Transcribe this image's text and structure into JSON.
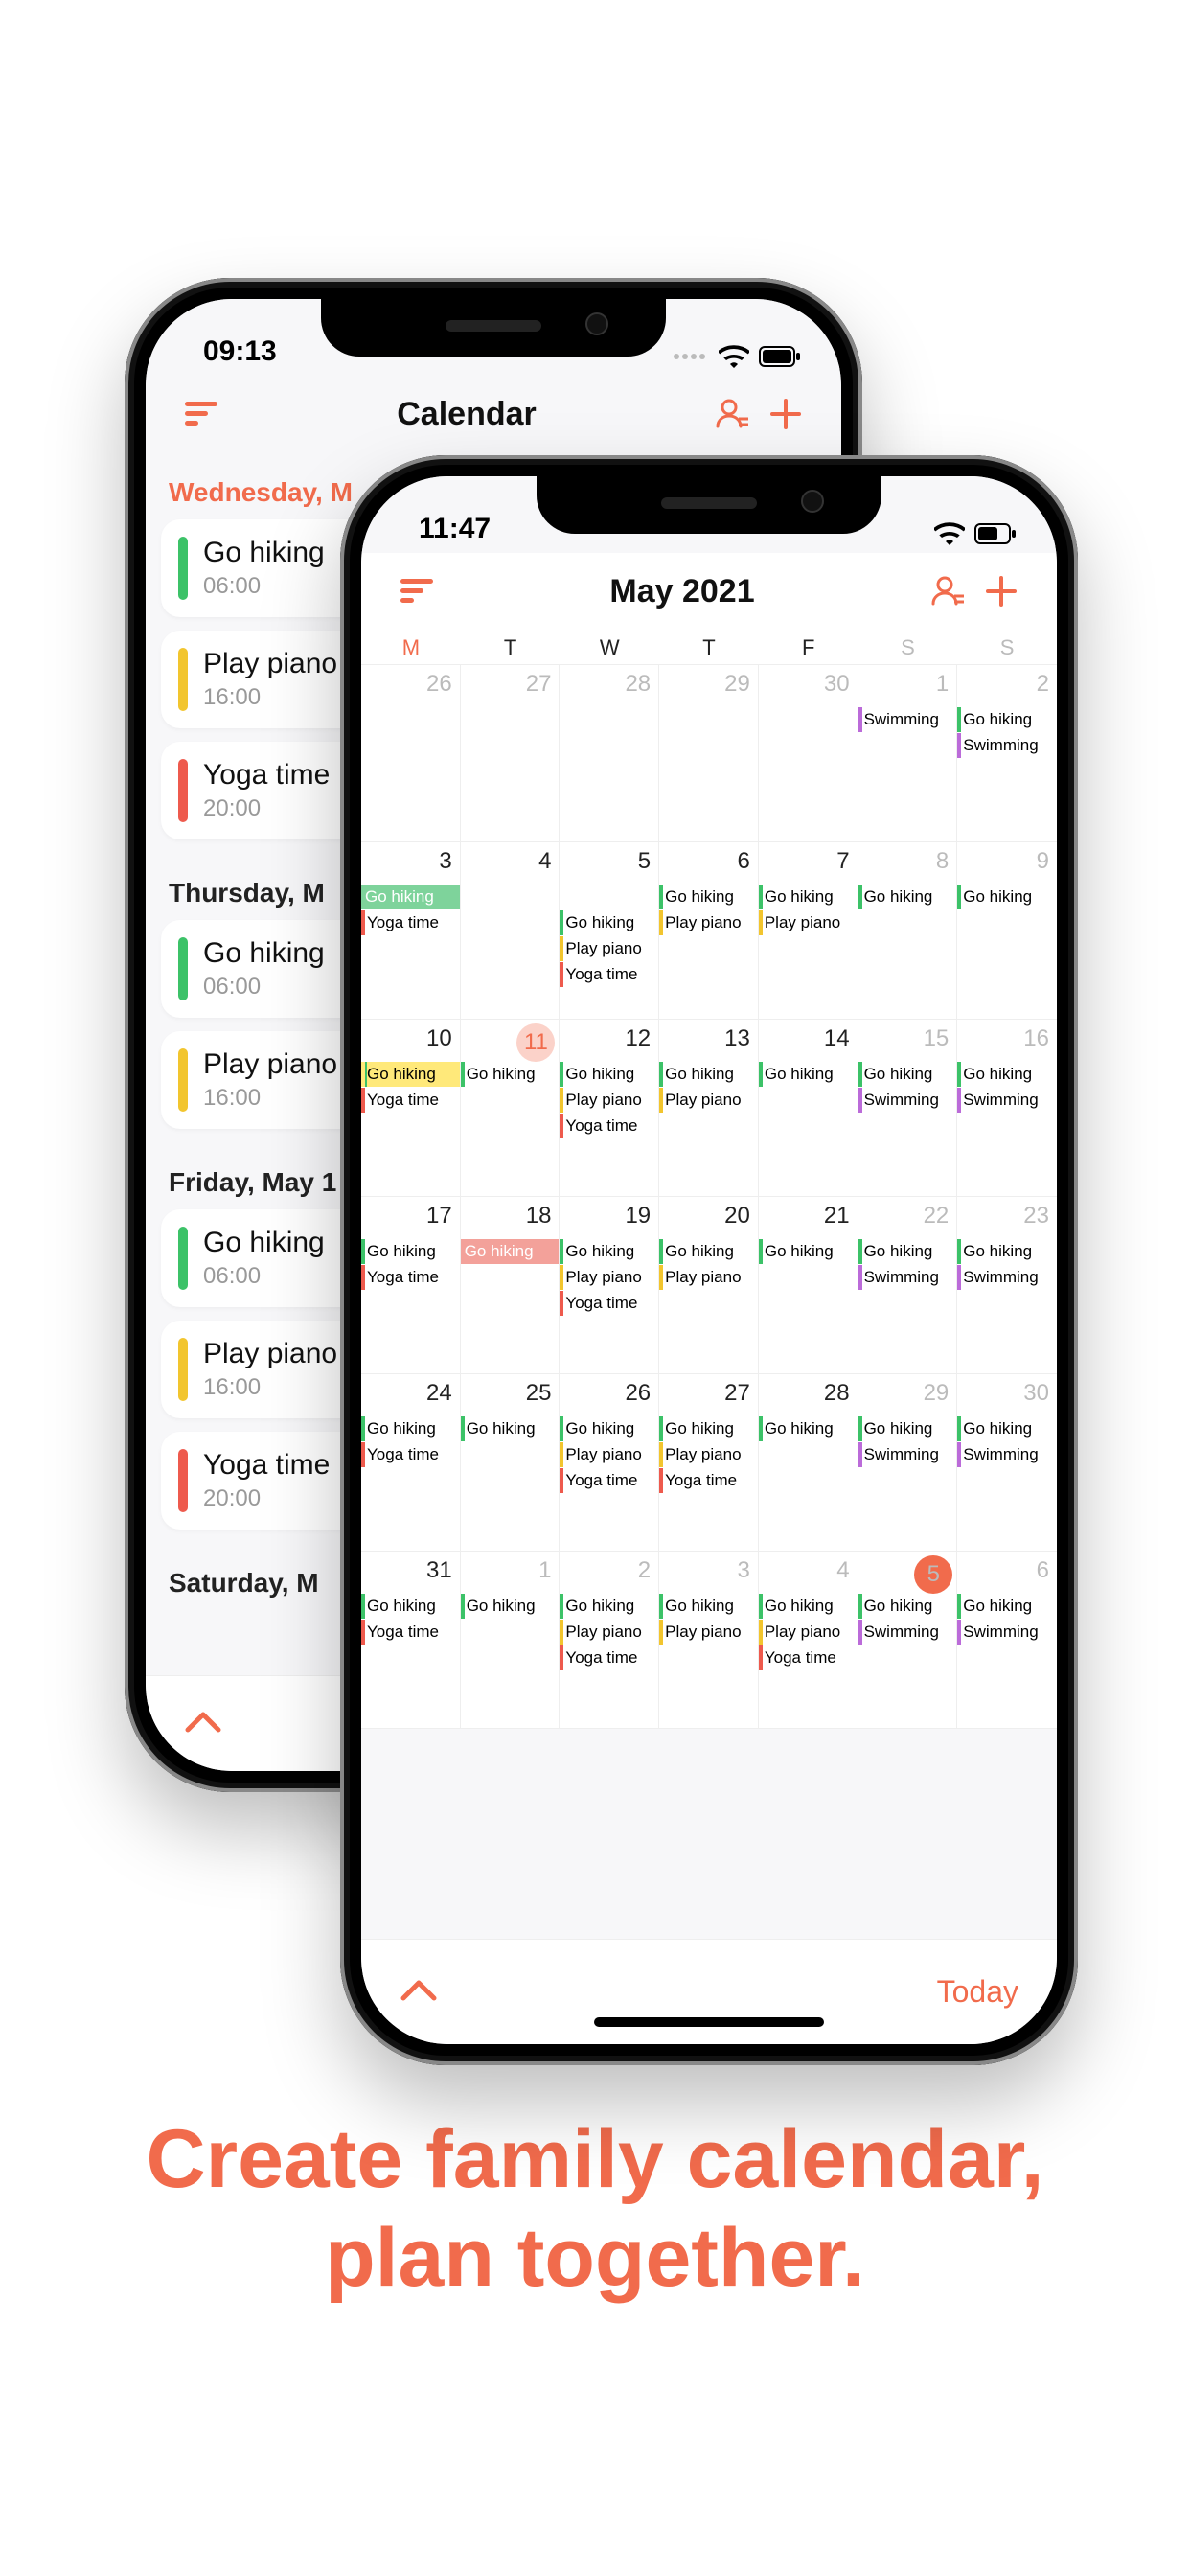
{
  "promo": {
    "line1": "Create family calendar,",
    "line2": "plan together."
  },
  "colors": {
    "accent": "#f16b4c",
    "green": "#3cc268",
    "yellow": "#f2c52e",
    "red": "#ee5a4d",
    "purple": "#bb6bd9"
  },
  "phoneA": {
    "status_time": "09:13",
    "nav_title": "Calendar",
    "sections": [
      {
        "date": "Wednesday, M",
        "accent": true,
        "items": [
          {
            "title": "Go hiking",
            "time": "06:00",
            "color": "green"
          },
          {
            "title": "Play piano",
            "time": "16:00",
            "color": "yellow"
          },
          {
            "title": "Yoga time",
            "time": "20:00",
            "color": "red"
          }
        ]
      },
      {
        "date": "Thursday, M",
        "accent": false,
        "items": [
          {
            "title": "Go hiking",
            "time": "06:00",
            "color": "green"
          },
          {
            "title": "Play piano",
            "time": "16:00",
            "color": "yellow"
          }
        ]
      },
      {
        "date": "Friday, May 1",
        "accent": false,
        "items": [
          {
            "title": "Go hiking",
            "time": "06:00",
            "color": "green"
          },
          {
            "title": "Play piano",
            "time": "16:00",
            "color": "yellow"
          },
          {
            "title": "Yoga time",
            "time": "20:00",
            "color": "red"
          }
        ]
      },
      {
        "date": "Saturday, M",
        "accent": false,
        "items": []
      }
    ]
  },
  "phoneB": {
    "status_time": "11:47",
    "nav_title": "May 2021",
    "weekdays": [
      "M",
      "T",
      "W",
      "T",
      "F",
      "S",
      "S"
    ],
    "today_label": "Today",
    "events": {
      "hiking": "Go hiking",
      "swimming": "Swimming",
      "yoga": "Yoga time",
      "piano": "Play piano"
    },
    "grid": [
      [
        {
          "d": 26,
          "other": true
        },
        {
          "d": 27,
          "other": true
        },
        {
          "d": 28,
          "other": true
        },
        {
          "d": 29,
          "other": true
        },
        {
          "d": 30,
          "other": true
        },
        {
          "d": 1,
          "wknd": true,
          "evts": [
            [
              "purple",
              "swimming"
            ]
          ]
        },
        {
          "d": 2,
          "wknd": true,
          "evts": [
            [
              "green",
              "hiking"
            ],
            [
              "purple",
              "swimming"
            ]
          ]
        }
      ],
      [
        {
          "d": 3,
          "span": {
            "color": "green",
            "label": "hiking",
            "len": 3
          },
          "evts": [
            [
              "red",
              "yoga"
            ]
          ]
        },
        {
          "d": 4,
          "spanCont": true
        },
        {
          "d": 5,
          "spanCont": true,
          "evts": [
            [
              "green",
              "hiking"
            ],
            [
              "yellow",
              "piano"
            ],
            [
              "red",
              "yoga"
            ]
          ]
        },
        {
          "d": 6,
          "evts": [
            [
              "green",
              "hiking"
            ],
            [
              "yellow",
              "piano"
            ]
          ]
        },
        {
          "d": 7,
          "evts": [
            [
              "green",
              "hiking"
            ],
            [
              "yellow",
              "piano"
            ]
          ]
        },
        {
          "d": 8,
          "wknd": true,
          "evts": [
            [
              "green",
              "hiking"
            ]
          ]
        },
        {
          "d": 9,
          "wknd": true,
          "evts": [
            [
              "green",
              "hiking"
            ]
          ]
        }
      ],
      [
        {
          "d": 10,
          "spanY": {
            "color": "yellow",
            "label": "hiking",
            "len": 1
          },
          "evts": [
            [
              "red",
              "yoga"
            ]
          ]
        },
        {
          "d": 11,
          "hl": true,
          "evts": [
            [
              "green",
              "hiking"
            ]
          ]
        },
        {
          "d": 12,
          "evts": [
            [
              "green",
              "hiking"
            ],
            [
              "yellow",
              "piano"
            ],
            [
              "red",
              "yoga"
            ]
          ]
        },
        {
          "d": 13,
          "evts": [
            [
              "green",
              "hiking"
            ],
            [
              "yellow",
              "piano"
            ]
          ]
        },
        {
          "d": 14,
          "evts": [
            [
              "green",
              "hiking"
            ]
          ]
        },
        {
          "d": 15,
          "wknd": true,
          "evts": [
            [
              "green",
              "hiking"
            ],
            [
              "purple",
              "swimming"
            ]
          ]
        },
        {
          "d": 16,
          "wknd": true,
          "evts": [
            [
              "green",
              "hiking"
            ],
            [
              "purple",
              "swimming"
            ]
          ]
        }
      ],
      [
        {
          "d": 17,
          "evts": [
            [
              "green",
              "hiking"
            ],
            [
              "red",
              "yoga"
            ]
          ]
        },
        {
          "d": 18,
          "spanR": {
            "color": "red",
            "label": "hiking"
          }
        },
        {
          "d": 19,
          "evts": [
            [
              "green",
              "hiking"
            ],
            [
              "yellow",
              "piano"
            ],
            [
              "red",
              "yoga"
            ]
          ]
        },
        {
          "d": 20,
          "evts": [
            [
              "green",
              "hiking"
            ],
            [
              "yellow",
              "piano"
            ]
          ]
        },
        {
          "d": 21,
          "evts": [
            [
              "green",
              "hiking"
            ]
          ]
        },
        {
          "d": 22,
          "wknd": true,
          "evts": [
            [
              "green",
              "hiking"
            ],
            [
              "purple",
              "swimming"
            ]
          ]
        },
        {
          "d": 23,
          "wknd": true,
          "evts": [
            [
              "green",
              "hiking"
            ],
            [
              "purple",
              "swimming"
            ]
          ]
        }
      ],
      [
        {
          "d": 24,
          "evts": [
            [
              "green",
              "hiking"
            ],
            [
              "red",
              "yoga"
            ]
          ]
        },
        {
          "d": 25,
          "evts": [
            [
              "green",
              "hiking"
            ]
          ]
        },
        {
          "d": 26,
          "evts": [
            [
              "green",
              "hiking"
            ],
            [
              "yellow",
              "piano"
            ],
            [
              "red",
              "yoga"
            ]
          ]
        },
        {
          "d": 27,
          "evts": [
            [
              "green",
              "hiking"
            ],
            [
              "yellow",
              "piano"
            ],
            [
              "red",
              "yoga"
            ]
          ]
        },
        {
          "d": 28,
          "evts": [
            [
              "green",
              "hiking"
            ]
          ]
        },
        {
          "d": 29,
          "wknd": true,
          "evts": [
            [
              "green",
              "hiking"
            ],
            [
              "purple",
              "swimming"
            ]
          ]
        },
        {
          "d": 30,
          "wknd": true,
          "evts": [
            [
              "green",
              "hiking"
            ],
            [
              "purple",
              "swimming"
            ]
          ]
        }
      ],
      [
        {
          "d": 31,
          "evts": [
            [
              "green",
              "hiking"
            ],
            [
              "red",
              "yoga"
            ]
          ]
        },
        {
          "d": 1,
          "other": true,
          "evts": [
            [
              "green",
              "hiking"
            ]
          ]
        },
        {
          "d": 2,
          "other": true,
          "evts": [
            [
              "green",
              "hiking"
            ],
            [
              "yellow",
              "piano"
            ],
            [
              "red",
              "yoga"
            ]
          ]
        },
        {
          "d": 3,
          "other": true,
          "evts": [
            [
              "green",
              "hiking"
            ],
            [
              "yellow",
              "piano"
            ]
          ]
        },
        {
          "d": 4,
          "other": true,
          "evts": [
            [
              "green",
              "hiking"
            ],
            [
              "yellow",
              "piano"
            ],
            [
              "red",
              "yoga"
            ]
          ]
        },
        {
          "d": 5,
          "other": true,
          "today": true,
          "evts": [
            [
              "green",
              "hiking"
            ],
            [
              "purple",
              "swimming"
            ]
          ]
        },
        {
          "d": 6,
          "other": true,
          "wknd": true,
          "evts": [
            [
              "green",
              "hiking"
            ],
            [
              "purple",
              "swimming"
            ]
          ]
        }
      ]
    ]
  }
}
